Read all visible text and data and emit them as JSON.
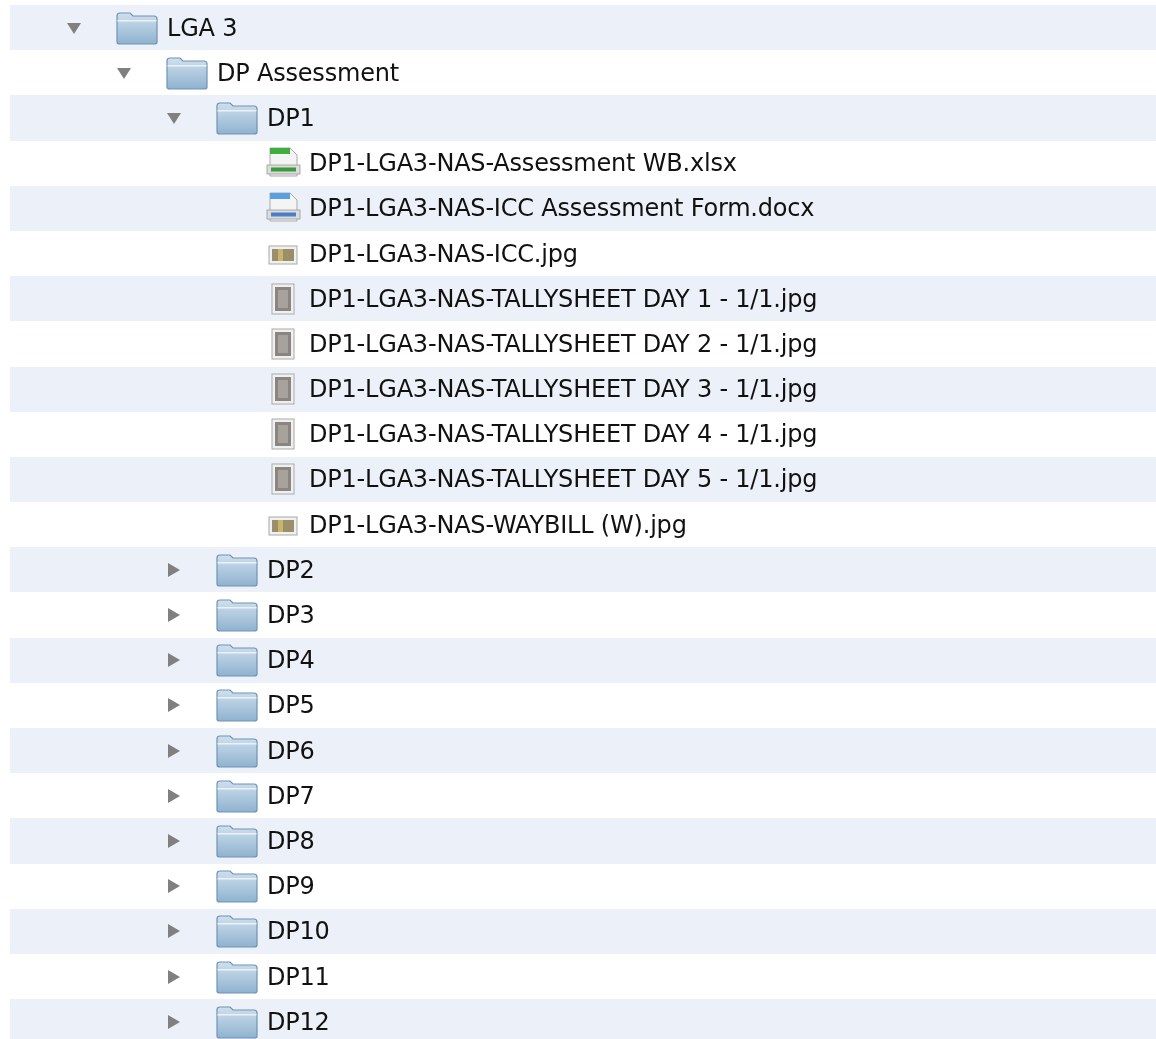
{
  "tree": [
    {
      "name": "LGA 3",
      "kind": "folder",
      "expanded": true,
      "children": [
        {
          "name": "DP Assessment",
          "kind": "folder",
          "expanded": true,
          "children": [
            {
              "name": "DP1",
              "kind": "folder",
              "expanded": true,
              "children": [
                {
                  "name": "DP1-LGA3-NAS-Assessment WB.xlsx",
                  "kind": "spreadsheet"
                },
                {
                  "name": "DP1-LGA3-NAS-ICC Assessment Form.docx",
                  "kind": "document"
                },
                {
                  "name": "DP1-LGA3-NAS-ICC.jpg",
                  "kind": "photo"
                },
                {
                  "name": "DP1-LGA3-NAS-TALLYSHEET DAY 1 - 1/1.jpg",
                  "kind": "scan"
                },
                {
                  "name": "DP1-LGA3-NAS-TALLYSHEET DAY 2 - 1/1.jpg",
                  "kind": "scan"
                },
                {
                  "name": "DP1-LGA3-NAS-TALLYSHEET DAY 3 - 1/1.jpg",
                  "kind": "scan"
                },
                {
                  "name": "DP1-LGA3-NAS-TALLYSHEET DAY 4 - 1/1.jpg",
                  "kind": "scan"
                },
                {
                  "name": "DP1-LGA3-NAS-TALLYSHEET DAY 5 - 1/1.jpg",
                  "kind": "scan"
                },
                {
                  "name": "DP1-LGA3-NAS-WAYBILL (W).jpg",
                  "kind": "photo"
                }
              ]
            },
            {
              "name": "DP2",
              "kind": "folder",
              "expanded": false
            },
            {
              "name": "DP3",
              "kind": "folder",
              "expanded": false
            },
            {
              "name": "DP4",
              "kind": "folder",
              "expanded": false
            },
            {
              "name": "DP5",
              "kind": "folder",
              "expanded": false
            },
            {
              "name": "DP6",
              "kind": "folder",
              "expanded": false
            },
            {
              "name": "DP7",
              "kind": "folder",
              "expanded": false
            },
            {
              "name": "DP8",
              "kind": "folder",
              "expanded": false
            },
            {
              "name": "DP9",
              "kind": "folder",
              "expanded": false
            },
            {
              "name": "DP10",
              "kind": "folder",
              "expanded": false
            },
            {
              "name": "DP11",
              "kind": "folder",
              "expanded": false
            },
            {
              "name": "DP12",
              "kind": "folder",
              "expanded": false
            }
          ]
        }
      ]
    }
  ]
}
